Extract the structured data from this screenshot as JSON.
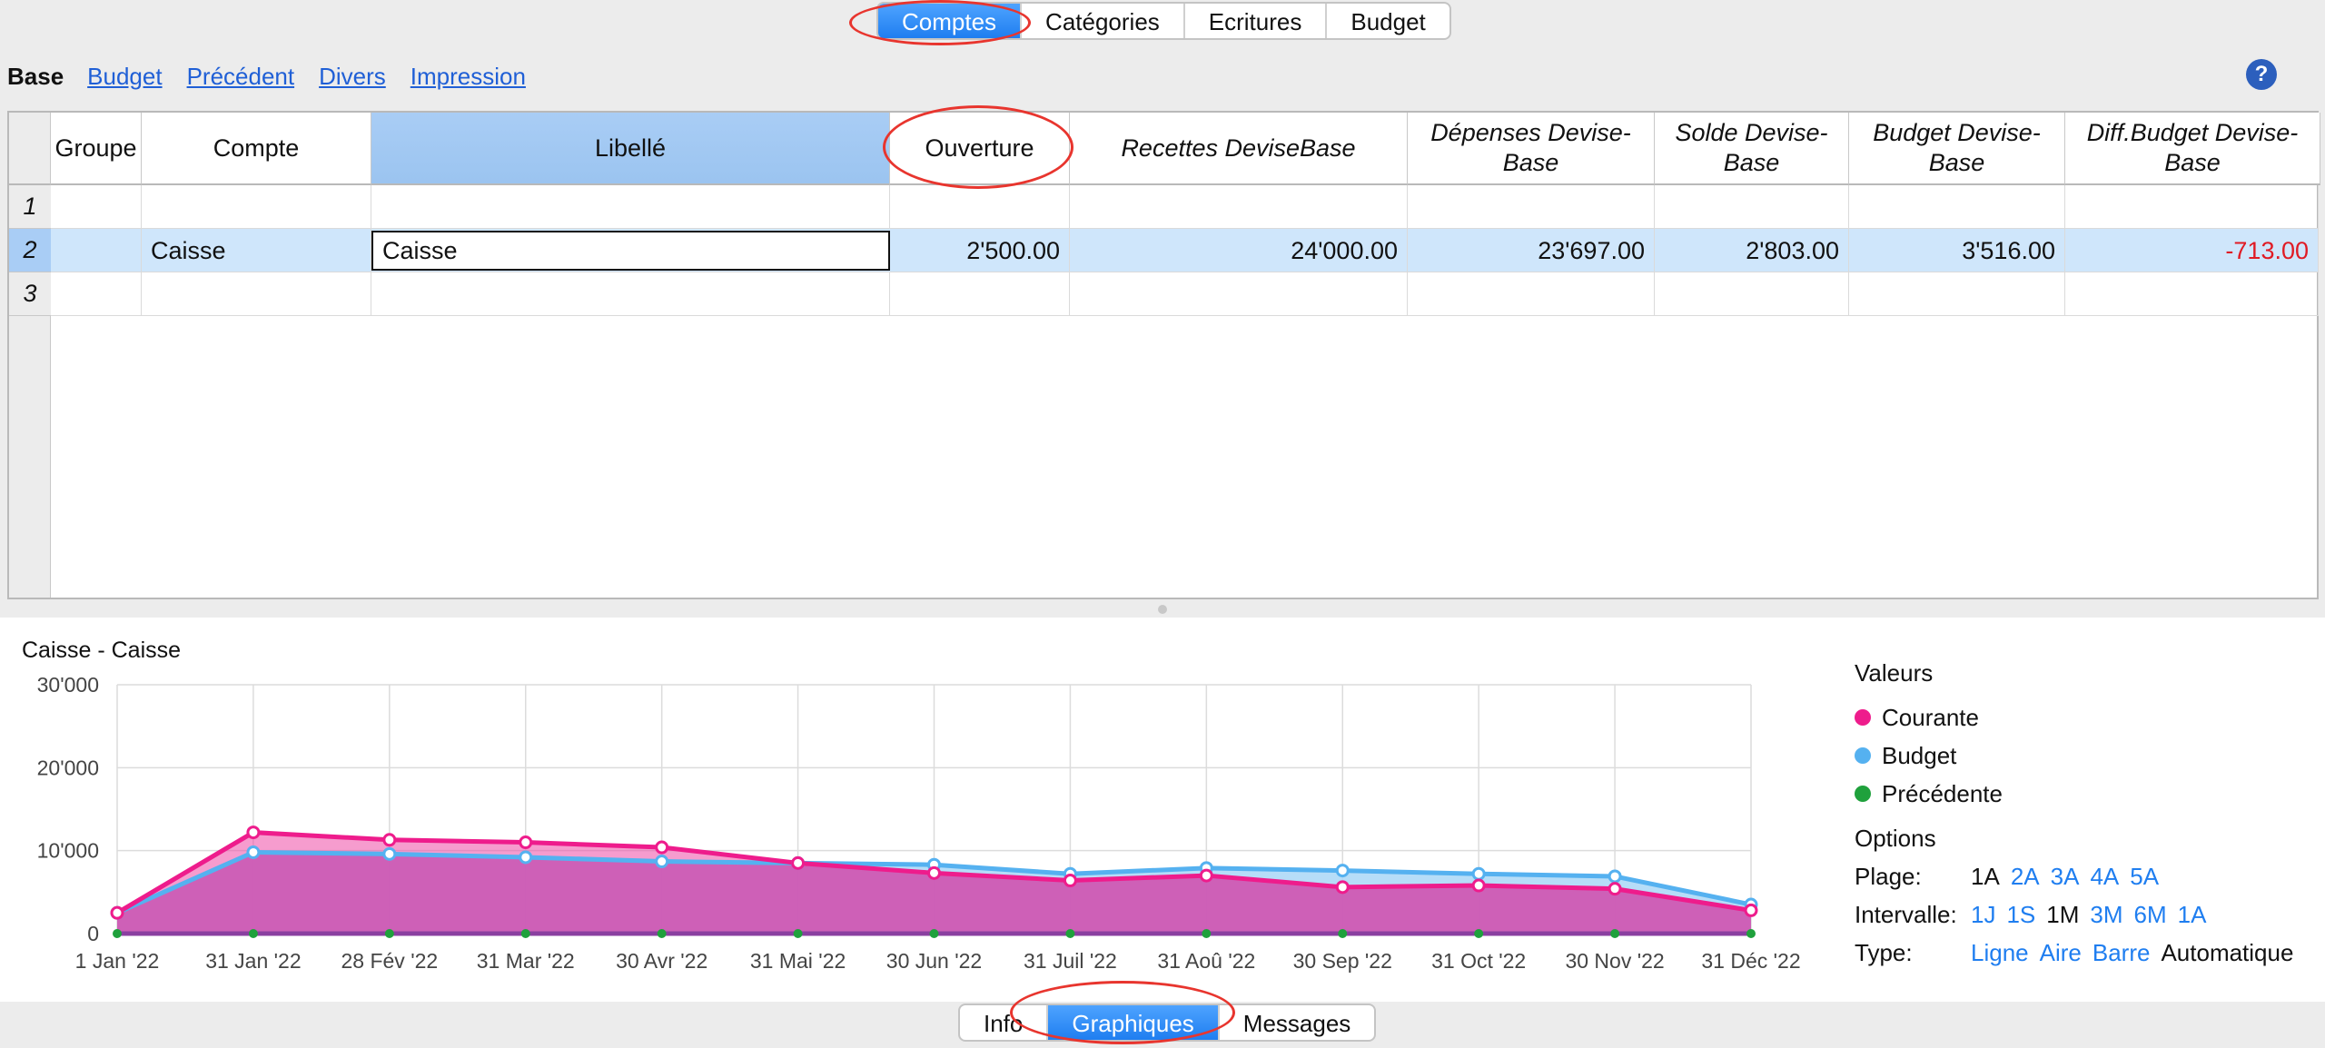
{
  "top_tabs": [
    "Comptes",
    "Catégories",
    "Ecritures",
    "Budget"
  ],
  "top_tab_active": 0,
  "view_bar": {
    "current": "Base",
    "links": [
      "Budget",
      "Précédent",
      "Divers",
      "Impression"
    ]
  },
  "help_icon": "?",
  "table": {
    "columns": [
      "Groupe",
      "Compte",
      "Libellé",
      "Ouverture",
      "Recettes DeviseBase",
      "Dépenses Devise-\nBase",
      "Solde Devise-\nBase",
      "Budget Devise-\nBase",
      "Diff.Budget Devise-\nBase"
    ],
    "row_numbers": [
      "1",
      "2",
      "3"
    ],
    "rows": [
      [
        "",
        "",
        "",
        "",
        "",
        "",
        "",
        "",
        ""
      ],
      [
        "",
        "Caisse",
        "Caisse",
        "2'500.00",
        "24'000.00",
        "23'697.00",
        "2'803.00",
        "3'516.00",
        "-713.00"
      ],
      [
        "",
        "",
        "",
        "",
        "",
        "",
        "",
        "",
        ""
      ]
    ],
    "selected_row": 1,
    "selected_column": 2
  },
  "chart_panel": {
    "title": "Caisse - Caisse",
    "legend_title": "Valeurs",
    "legend": [
      {
        "name": "Courante",
        "color": "#ee1c8c"
      },
      {
        "name": "Budget",
        "color": "#55b1f0"
      },
      {
        "name": "Précédente",
        "color": "#1fa13c"
      }
    ],
    "options_title": "Options",
    "options": [
      {
        "label": "Plage:",
        "items": [
          "1A",
          "2A",
          "3A",
          "4A",
          "5A"
        ],
        "current": "1A"
      },
      {
        "label": "Intervalle:",
        "items": [
          "1J",
          "1S",
          "1M",
          "3M",
          "6M",
          "1A"
        ],
        "current": "1M"
      },
      {
        "label": "Type:",
        "items": [
          "Ligne",
          "Aire",
          "Barre",
          "Automatique"
        ],
        "current": "Automatique"
      }
    ]
  },
  "chart_data": {
    "type": "area",
    "title": "Caisse - Caisse",
    "categories": [
      "1 Jan '22",
      "31 Jan '22",
      "28 Fév '22",
      "31 Mar '22",
      "30 Avr '22",
      "31 Mai '22",
      "30 Jun '22",
      "31 Juil '22",
      "31 Aoû '22",
      "30 Sep '22",
      "31 Oct '22",
      "30 Nov '22",
      "31 Déc '22"
    ],
    "y_ticks": [
      "0",
      "10'000",
      "20'000",
      "30'000"
    ],
    "ylim": [
      0,
      30000
    ],
    "grid": true,
    "legend_position": "right",
    "series": [
      {
        "name": "Courante",
        "color": "#ee1c8c",
        "values": [
          2500,
          12200,
          11300,
          11000,
          10400,
          8500,
          7300,
          6400,
          7000,
          5600,
          5800,
          5400,
          2800
        ]
      },
      {
        "name": "Budget",
        "color": "#55b1f0",
        "values": [
          2500,
          9800,
          9600,
          9200,
          8700,
          8500,
          8300,
          7200,
          7900,
          7600,
          7200,
          6900,
          3500
        ]
      },
      {
        "name": "Précédente",
        "color": "#1fa13c",
        "values": [
          0,
          0,
          0,
          0,
          0,
          0,
          0,
          0,
          0,
          0,
          0,
          0,
          0
        ]
      }
    ]
  },
  "bottom_tabs": [
    "Info",
    "Graphiques",
    "Messages"
  ],
  "bottom_tab_active": 1
}
